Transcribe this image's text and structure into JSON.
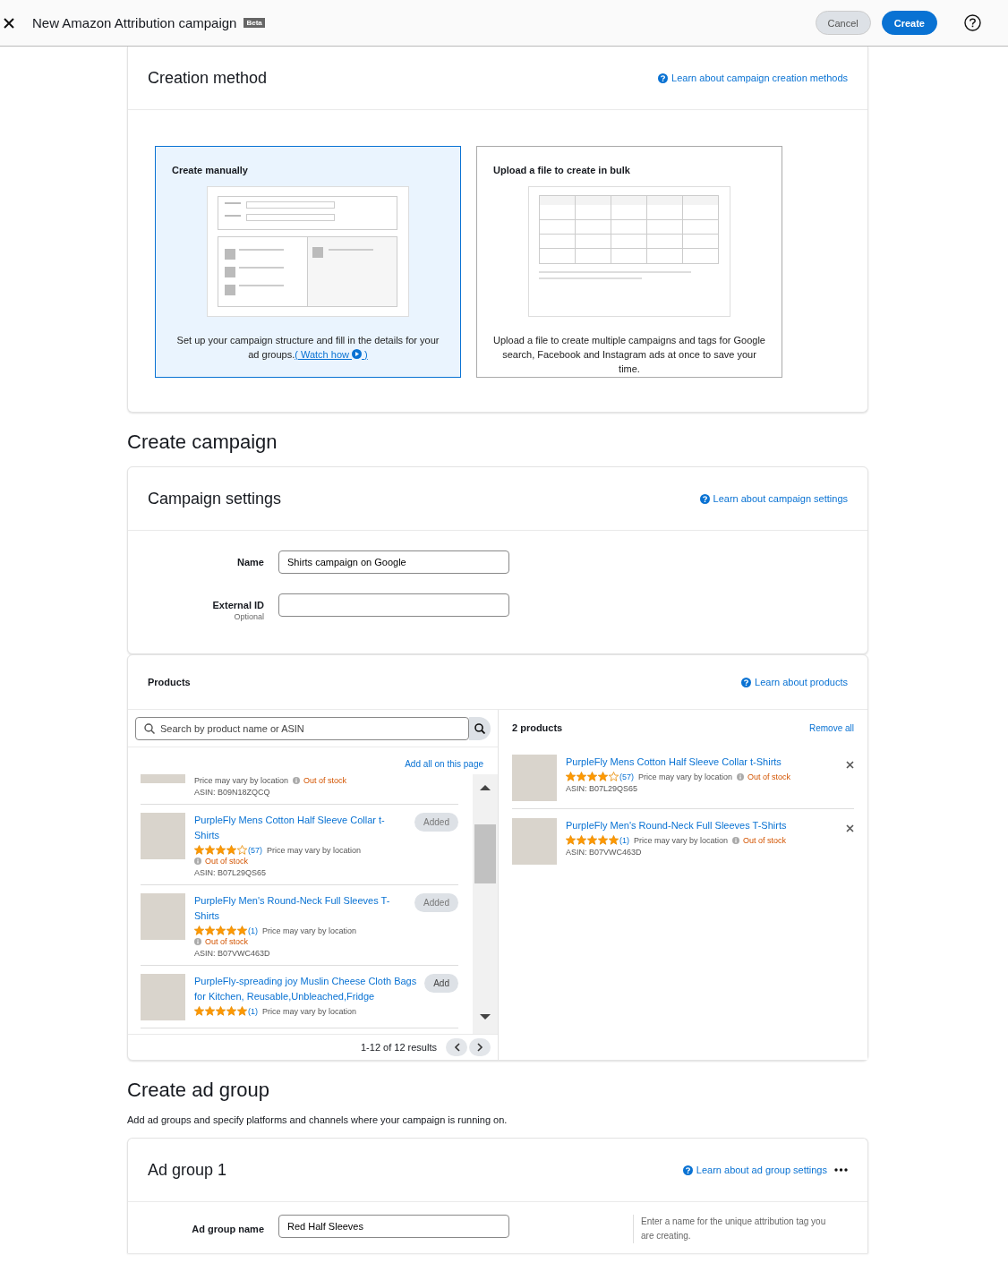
{
  "header": {
    "title": "New Amazon Attribution campaign",
    "badge": "Beta",
    "buttons": [
      {
        "label": "Cancel",
        "kind": "secondary"
      },
      {
        "label": "Create",
        "kind": "primary"
      }
    ]
  },
  "creation_method": {
    "title": "Creation method",
    "learn_link": "Learn about campaign creation methods",
    "options": [
      {
        "title": "Create manually",
        "kind": "manual",
        "selected": true,
        "description": "Set up your campaign structure and fill in the details for your ad groups.",
        "link_open": "( Watch how",
        "link_close": ")"
      },
      {
        "title": "Upload a file to create in bulk",
        "kind": "bulk",
        "selected": false,
        "description": "Upload a file to create multiple campaigns and tags for Google search, Facebook and Instagram ads at once to save your time."
      }
    ]
  },
  "create_campaign": {
    "heading": "Create campaign"
  },
  "campaign_settings": {
    "title": "Campaign settings",
    "learn_link": "Learn about campaign settings",
    "fields": [
      {
        "label": "Name",
        "value": "Shirts campaign on Google"
      },
      {
        "label": "External ID",
        "sublabel": "Optional"
      }
    ]
  },
  "products": {
    "title": "Products",
    "learn_link": "Learn about products",
    "search_placeholder": "Search by product name or ASIN",
    "add_all": "Add all on this page",
    "results": [
      {
        "price_note": "Price may vary by location",
        "stock": "Out of stock",
        "asin": "ASIN: B09N18ZQCQ"
      },
      {
        "title": "PurpleFly Mens Cotton Half Sleeve Collar t-Shirts",
        "stars": 4,
        "reviews": "(57)",
        "price_note": "Price may vary by location",
        "stock": "Out of stock",
        "asin": "ASIN: B07L29QS65",
        "action": "Added",
        "added": true
      },
      {
        "title": "PurpleFly Men's Round-Neck Full Sleeves T-Shirts",
        "stars": 5,
        "reviews": "(1)",
        "price_note": "Price may vary by location",
        "stock": "Out of stock",
        "asin": "ASIN: B07VWC463D",
        "action": "Added",
        "added": true
      },
      {
        "title": "PurpleFly-spreading joy Muslin Cheese Cloth Bags for Kitchen, Reusable,Unbleached,Fridge",
        "stars": 5,
        "reviews": "(1)",
        "price_note": "Price may vary by location",
        "action": "Add",
        "added": false
      }
    ],
    "pagination": "1-12 of 12 results",
    "selected_count": "2 products",
    "remove_all": "Remove all",
    "selected_items": [
      {
        "title": "PurpleFly Mens Cotton Half Sleeve Collar t-Shirts",
        "stars": 4,
        "reviews": "(57)",
        "price_note": "Price may vary by location",
        "stock": "Out of stock",
        "asin": "ASIN: B07L29QS65"
      },
      {
        "title": "PurpleFly Men's Round-Neck Full Sleeves T-Shirts",
        "stars": 5,
        "reviews": "(1)",
        "price_note": "Price may vary by location",
        "stock": "Out of stock",
        "asin": "ASIN: B07VWC463D"
      }
    ]
  },
  "create_ad_group": {
    "heading": "Create ad group",
    "description": "Add ad groups and specify platforms and channels where your campaign is running on."
  },
  "ad_group": {
    "title": "Ad group 1",
    "learn_link": "Learn about ad group settings",
    "field": {
      "label": "Ad group name",
      "value": "Red Half Sleeves"
    },
    "hint": "Enter a name for the unique attribution tag you are creating."
  }
}
